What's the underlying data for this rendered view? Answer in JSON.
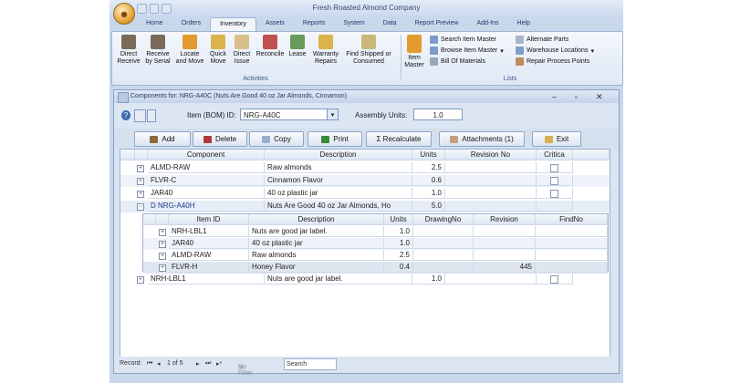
{
  "app": {
    "title": "Fresh Roasted Almond Company",
    "tabs": [
      "Home",
      "Orders",
      "Inventory",
      "Assets",
      "Reports",
      "System",
      "Data",
      "Report Preview",
      "Add-Ins",
      "Help"
    ],
    "active_tab": "Inventory"
  },
  "ribbon": {
    "activities": {
      "label": "Activities",
      "buttons": [
        {
          "label": "Direct Receive",
          "icon": "receive-icon"
        },
        {
          "label": "Receive by Serial",
          "icon": "receive-serial-icon"
        },
        {
          "label": "Locate and Move",
          "icon": "locate-icon"
        },
        {
          "label": "Quick Move",
          "icon": "quick-move-icon"
        },
        {
          "label": "Direct Issue",
          "icon": "issue-icon"
        },
        {
          "label": "Reconcile",
          "icon": "reconcile-icon"
        },
        {
          "label": "Lease",
          "icon": "lease-icon"
        },
        {
          "label": "Warranty Repairs",
          "icon": "warranty-icon"
        },
        {
          "label": "Find Shipped or Consumed",
          "icon": "find-shipped-icon"
        }
      ]
    },
    "lists": {
      "label": "Lists",
      "item_master": "Item Master",
      "small": [
        "Search Item Master",
        "Browse Item Master",
        "Bill Of Materials"
      ],
      "small2": [
        "Alternate Parts",
        "Warehouse Locations",
        "Repair Process Points"
      ]
    }
  },
  "form": {
    "title": "Components for: NRG-A40C (Nuts Are Good 40 oz Jar Almonds, Cinnamon)",
    "item_label": "Item (BOM) ID:",
    "item_value": "NRG-A40C",
    "assembly_label": "Assembly Units:",
    "assembly_value": "1.0",
    "buttons": [
      "Add",
      "Delete",
      "Copy",
      "Print",
      "Σ Recalculate",
      "Attachments (1)",
      "Exit"
    ]
  },
  "grid": {
    "headers": [
      "Component",
      "Description",
      "Units",
      "Revision No",
      "Critica"
    ],
    "rows": [
      {
        "component": "ALMD-RAW",
        "description": "Raw almonds",
        "units": "2.5"
      },
      {
        "component": "FLVR-C",
        "description": "Cinnamon Flavor",
        "units": "0.6"
      },
      {
        "component": "JAR40",
        "description": "40 oz plastic jar",
        "units": "1.0"
      },
      {
        "component": "NRG-A40H",
        "description": "Nuts Are Good 40 oz Jar Almonds, Ho",
        "units": "5.0"
      },
      {
        "component": "NRH-LBL1",
        "description": "Nuts are good jar label.",
        "units": "1.0"
      }
    ],
    "expanded_marker": "D",
    "sub": {
      "headers": [
        "Item ID",
        "Description",
        "Units",
        "DrawingNo",
        "Revision",
        "FindNo"
      ],
      "rows": [
        {
          "item": "NRH-LBL1",
          "description": "Nuts are good jar label.",
          "units": "1.0",
          "revision": ""
        },
        {
          "item": "JAR40",
          "description": "40 oz plastic jar",
          "units": "1.0",
          "revision": ""
        },
        {
          "item": "ALMD-RAW",
          "description": "Raw almonds",
          "units": "2.5",
          "revision": ""
        },
        {
          "item": "FLVR-H",
          "description": "Honey Flavor",
          "units": "0.4",
          "revision": "445"
        }
      ]
    }
  },
  "nav": {
    "record_label": "Record:",
    "position": "1 of 5",
    "filter": "No Filter",
    "search": "Search"
  }
}
